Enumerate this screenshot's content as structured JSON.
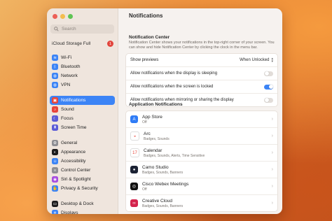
{
  "window": {
    "title": "Notifications"
  },
  "traffic_lights": {
    "close": "#ec5f56",
    "minimize": "#f4bd4f",
    "zoom": "#5fc454"
  },
  "search": {
    "placeholder": "Search"
  },
  "icloud": {
    "label": "iCloud Storage Full",
    "badge": "1"
  },
  "sidebar": {
    "groups": [
      [
        {
          "label": "Wi-Fi",
          "icon": "wifi-icon",
          "color": "#3c84f6"
        },
        {
          "label": "Bluetooth",
          "icon": "bluetooth-icon",
          "color": "#3c84f6"
        },
        {
          "label": "Network",
          "icon": "network-icon",
          "color": "#3c84f6"
        },
        {
          "label": "VPN",
          "icon": "vpn-icon",
          "color": "#3c84f6"
        }
      ],
      [
        {
          "label": "Notifications",
          "icon": "notifications-icon",
          "color": "#e8443a",
          "selected": true
        },
        {
          "label": "Sound",
          "icon": "sound-icon",
          "color": "#e8443a"
        },
        {
          "label": "Focus",
          "icon": "focus-icon",
          "color": "#5b5bd6"
        },
        {
          "label": "Screen Time",
          "icon": "screen-time-icon",
          "color": "#5b5bd6"
        }
      ],
      [
        {
          "label": "General",
          "icon": "general-icon",
          "color": "#8e8e93"
        },
        {
          "label": "Appearance",
          "icon": "appearance-icon",
          "color": "#1c1c1e"
        },
        {
          "label": "Accessibility",
          "icon": "accessibility-icon",
          "color": "#3c84f6"
        },
        {
          "label": "Control Center",
          "icon": "control-center-icon",
          "color": "#8e8e93"
        },
        {
          "label": "Siri & Spotlight",
          "icon": "siri-icon",
          "color": "#a74ce0"
        },
        {
          "label": "Privacy & Security",
          "icon": "privacy-icon",
          "color": "#3c84f6"
        }
      ],
      [
        {
          "label": "Desktop & Dock",
          "icon": "desktop-dock-icon",
          "color": "#1c1c1e"
        },
        {
          "label": "Displays",
          "icon": "displays-icon",
          "color": "#3c84f6"
        }
      ]
    ]
  },
  "notification_center": {
    "heading": "Notification Center",
    "description": "Notification Center shows your notifications in the top-right corner of your screen. You can show and hide Notification Center by clicking the clock in the menu bar."
  },
  "settings": [
    {
      "label": "Show previews",
      "type": "select",
      "value": "When Unlocked"
    },
    {
      "label": "Allow notifications when the display is sleeping",
      "type": "toggle",
      "on": false
    },
    {
      "label": "Allow notifications when the screen is locked",
      "type": "toggle",
      "on": true
    },
    {
      "label": "Allow notifications when mirroring or sharing the display",
      "type": "toggle",
      "on": false
    }
  ],
  "app_notifications": {
    "heading": "Application Notifications",
    "apps": [
      {
        "name": "App Store",
        "sub": "Off",
        "icon": "app-store-icon",
        "color": "#2f7cf6"
      },
      {
        "name": "Arc",
        "sub": "Badges, Sounds",
        "icon": "arc-icon",
        "color": "#ffffff"
      },
      {
        "name": "Calendar",
        "sub": "Badges, Sounds, Alerts, Time Sensitive",
        "icon": "calendar-icon",
        "color": "#ffffff"
      },
      {
        "name": "Camo Studio",
        "sub": "Badges, Sounds, Banners",
        "icon": "camo-studio-icon",
        "color": "#1b2233"
      },
      {
        "name": "Cisco Webex Meetings",
        "sub": "Off",
        "icon": "webex-icon",
        "color": "#111111"
      },
      {
        "name": "Creative Cloud",
        "sub": "Badges, Sounds, Banners",
        "icon": "creative-cloud-icon",
        "color": "#d4244d"
      }
    ]
  }
}
